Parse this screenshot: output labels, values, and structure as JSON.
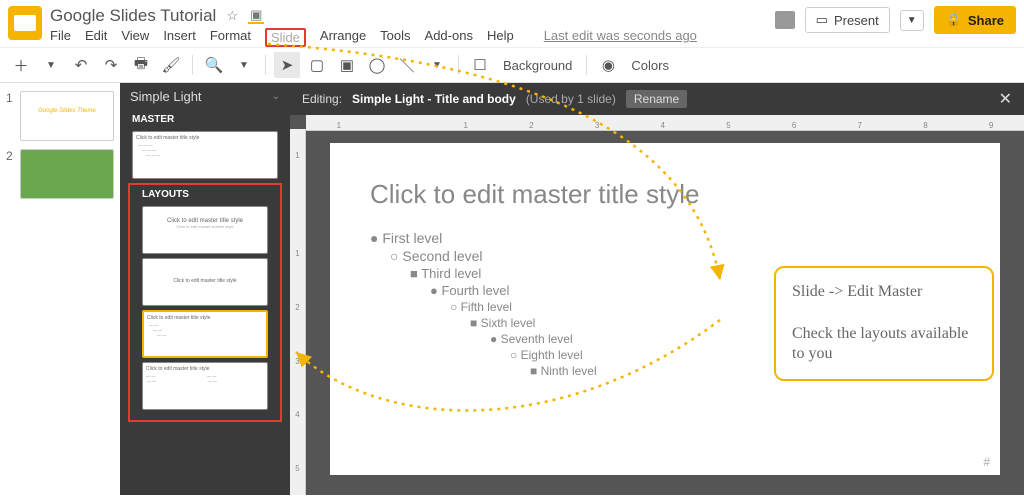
{
  "header": {
    "doc_title": "Google Slides Tutorial",
    "menu": [
      "File",
      "Edit",
      "View",
      "Insert",
      "Format",
      "Slide",
      "Arrange",
      "Tools",
      "Add-ons",
      "Help"
    ],
    "menu_highlight_index": 5,
    "last_edit": "Last edit was seconds ago",
    "present": "Present",
    "share": "Share"
  },
  "toolbar": {
    "background": "Background",
    "colors": "Colors"
  },
  "slides_nav": {
    "items": [
      {
        "num": "1",
        "preview": "Google Slides Theme"
      },
      {
        "num": "2",
        "preview": ""
      }
    ]
  },
  "master_panel": {
    "theme_name": "Simple Light",
    "master_label": "MASTER",
    "layouts_label": "LAYOUTS",
    "master_thumb_text": "Click to edit master title style",
    "layout_thumbs": [
      "Click to edit master title style",
      "Click to edit master title style",
      "Click to edit master title style",
      "Click to edit master title style"
    ],
    "selected_layout_index": 2
  },
  "edit_bar": {
    "prefix": "Editing:",
    "title": "Simple Light - Title and body",
    "usage": "(Used by 1 slide)",
    "rename": "Rename"
  },
  "canvas": {
    "title": "Click to edit master title style",
    "levels": [
      "First level",
      "Second level",
      "Third level",
      "Fourth level",
      "Fifth level",
      "Sixth level",
      "Seventh level",
      "Eighth level",
      "Ninth level"
    ]
  },
  "callout": {
    "line1": "Slide -> Edit Master",
    "line2": "Check the layouts available to you"
  },
  "ruler": {
    "h": [
      "1",
      "",
      "1",
      "2",
      "3",
      "4",
      "5",
      "6",
      "7",
      "8",
      "9"
    ],
    "v": [
      "1",
      "",
      "1",
      "2",
      "3",
      "4",
      "5"
    ]
  },
  "hash": "#"
}
